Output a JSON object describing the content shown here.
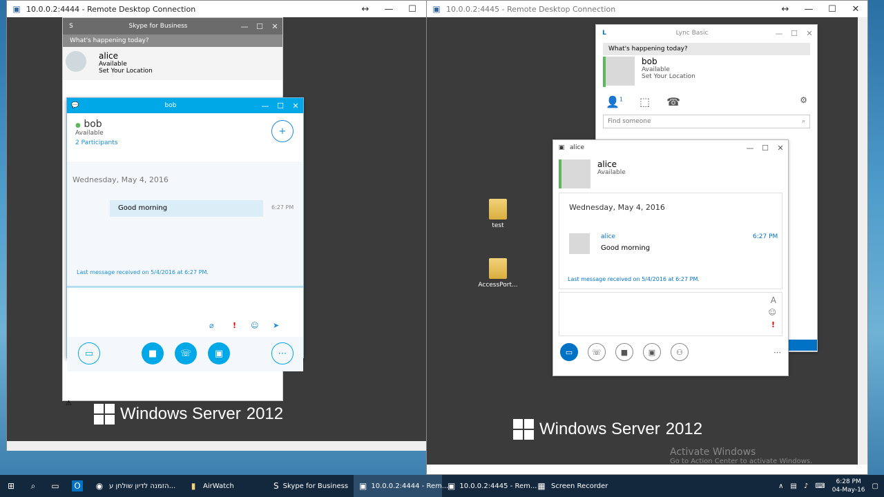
{
  "rdp1": {
    "title": "10.0.0.2:4444 - Remote Desktop Connection",
    "os_label": "Windows Server",
    "os_version": "2012"
  },
  "rdp2": {
    "title": "10.0.0.2:4445 - Remote Desktop Connection",
    "os_label": "Windows Server",
    "os_version": "2012"
  },
  "skype_main": {
    "title": "Skype for Business",
    "happening": "What's happening today?",
    "user": "alice",
    "status": "Available",
    "location": "Set Your Location"
  },
  "skype_chat": {
    "title": "bob",
    "contact": "bob",
    "status": "Available",
    "participants": "2 Participants",
    "date": "Wednesday, May 4, 2016",
    "message": "Good morning",
    "time": "6:27 PM",
    "last_msg": "Last message received on 5/4/2016 at 6:27 PM."
  },
  "lync_main": {
    "title": "Lync Basic",
    "happening": "What's happening today?",
    "user": "bob",
    "status": "Available",
    "location": "Set Your Location",
    "contacts_count": "1",
    "search_placeholder": "Find someone"
  },
  "lync_chat": {
    "title": "alice",
    "contact": "alice",
    "status": "Available",
    "date": "Wednesday, May 4, 2016",
    "sender": "alice",
    "message": "Good morning",
    "time": "6:27 PM",
    "last_msg": "Last message received on 5/4/2016 at 6:27 PM."
  },
  "desktop_icons": [
    {
      "label": "test"
    },
    {
      "label": "AccessPort..."
    }
  ],
  "watermark": {
    "line1": "Activate Windows",
    "line2": "Go to Action Center to activate Windows."
  },
  "taskbar": {
    "items": [
      {
        "label": "הזמנה לדיון שולחן ע..."
      },
      {
        "label": "AirWatch"
      },
      {
        "label": "Skype for Business"
      },
      {
        "label": "10.0.0.2:4444 - Rem..."
      },
      {
        "label": "10.0.0.2:4445 - Rem..."
      },
      {
        "label": "Screen Recorder"
      }
    ],
    "time": "6:28 PM",
    "date": "04-May-16"
  }
}
